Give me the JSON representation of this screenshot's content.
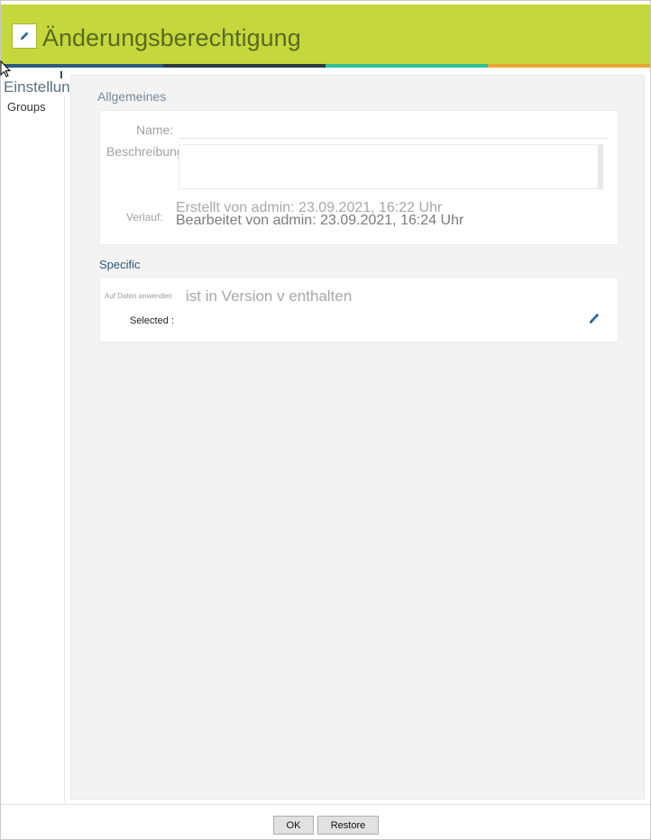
{
  "window": {
    "title": "Änderungsberechtigung"
  },
  "header": {
    "accent_color": "#c4d83d",
    "bar_colors": [
      "#2d5b7a",
      "#2b3a42",
      "#2dbf93",
      "#e8a531"
    ]
  },
  "tabs": {
    "settings_label": "Einstellungen"
  },
  "sidebar": {
    "items": [
      {
        "label": "Groups"
      }
    ]
  },
  "general": {
    "title": "Allgemeines",
    "name_label": "Name:",
    "name_value": "",
    "description_label": "Beschreibung:",
    "description_value": "",
    "history_label": "Verlauf:",
    "created": "Erstellt von admin: 23.09.2021, 16:22 Uhr",
    "edited": "Bearbeitet von admin: 23.09.2021, 16:24 Uhr"
  },
  "specific": {
    "title": "Specific",
    "apply_label": "Auf Daten anwenden",
    "apply_text": "ist in Version v enthalten",
    "selected_label": "Selected :",
    "edit_icon": "pencil-icon"
  },
  "footer": {
    "ok_label": "OK",
    "restore_label": "Restore"
  }
}
